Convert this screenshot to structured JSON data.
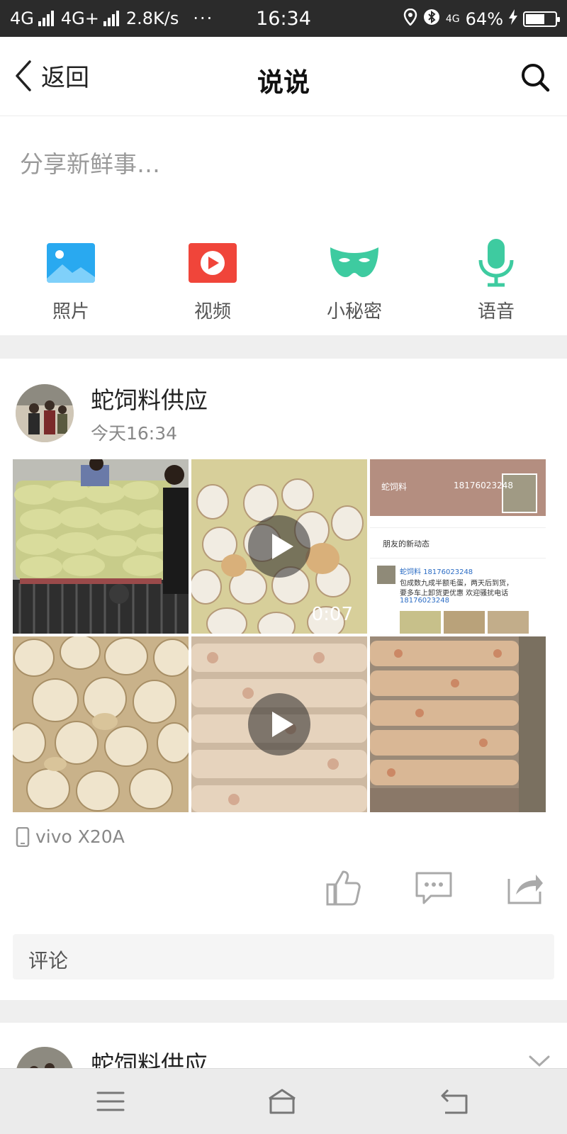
{
  "status_bar": {
    "network1": "4G",
    "network2": "4G+",
    "speed": "2.8K/s",
    "more": "···",
    "time": "16:34",
    "net_type": "4G",
    "battery_text": "64%",
    "battery_level": 0.64
  },
  "nav": {
    "back_label": "返回",
    "title": "说说"
  },
  "compose": {
    "placeholder": "分享新鲜事…",
    "actions": [
      {
        "label": "照片",
        "icon": "photo-icon",
        "color": "#29a9f0"
      },
      {
        "label": "视频",
        "icon": "video-icon",
        "color": "#f0453a"
      },
      {
        "label": "小秘密",
        "icon": "mask-icon",
        "color": "#3ecba0"
      },
      {
        "label": "语音",
        "icon": "microphone-icon",
        "color": "#3ecba0"
      }
    ]
  },
  "post": {
    "author": "蛇饲料供应",
    "time": "今天16:34",
    "media": [
      {
        "type": "image",
        "desc": "sacks-on-cart"
      },
      {
        "type": "video",
        "duration": "0:07"
      },
      {
        "type": "image",
        "desc": "screenshot"
      },
      {
        "type": "image",
        "desc": "eggs"
      },
      {
        "type": "video"
      },
      {
        "type": "image",
        "desc": "sacks"
      }
    ],
    "embedded_screenshot": {
      "name_line": "蛇饲料",
      "phone_line": "18176023248",
      "feed_title": "朋友的新动态",
      "name_line2": "蛇饲料",
      "phone_line2": "18176023248",
      "body_line1": "包成数九成半额毛蛋，两天后到货，",
      "body_line2": "要多车上卸货更优惠      欢迎骚扰电话",
      "body_line3": "18176023248"
    },
    "device": "vivo X20A",
    "comment_placeholder": "评论"
  },
  "post2": {
    "author": "蛇饲料供应"
  },
  "colors": {
    "accent_green": "#3ecba0",
    "photo_blue": "#29a9f0",
    "video_red": "#f0453a"
  }
}
